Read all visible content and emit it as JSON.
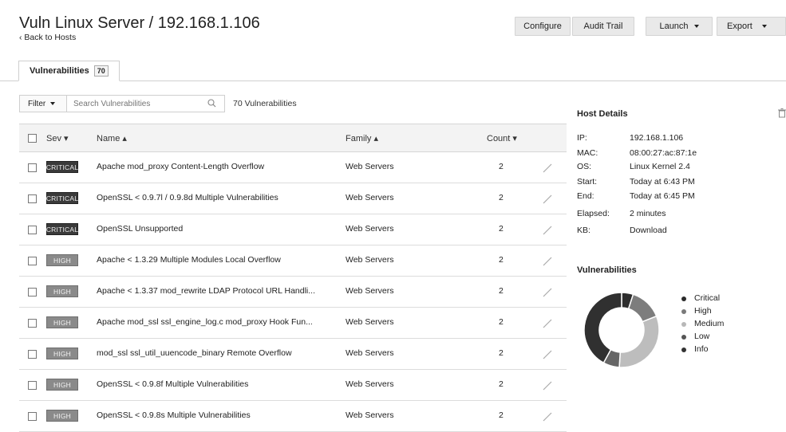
{
  "header": {
    "title": "Vuln Linux Server / 192.168.1.106",
    "back_link": "‹ Back to Hosts",
    "buttons": {
      "configure": "Configure",
      "audit_trail": "Audit Trail",
      "launch": "Launch",
      "export": "Export"
    }
  },
  "tabs": [
    {
      "label": "Vulnerabilities",
      "count": "70"
    }
  ],
  "toolbar": {
    "filter_label": "Filter",
    "search_placeholder": "Search Vulnerabilities",
    "result_count": "70 Vulnerabilities"
  },
  "table": {
    "columns": {
      "sev": "Sev ▾",
      "name": "Name ▴",
      "family": "Family ▴",
      "count": "Count ▾"
    },
    "rows": [
      {
        "sev": "CRITICAL",
        "name": "Apache mod_proxy Content-Length Overflow",
        "family": "Web Servers",
        "count": "2"
      },
      {
        "sev": "CRITICAL",
        "name": "OpenSSL < 0.9.7l / 0.9.8d Multiple Vulnerabilities",
        "family": "Web Servers",
        "count": "2"
      },
      {
        "sev": "CRITICAL",
        "name": "OpenSSL Unsupported",
        "family": "Web Servers",
        "count": "2"
      },
      {
        "sev": "HIGH",
        "name": "Apache < 1.3.29 Multiple Modules Local Overflow",
        "family": "Web Servers",
        "count": "2"
      },
      {
        "sev": "HIGH",
        "name": "Apache < 1.3.37 mod_rewrite LDAP Protocol URL Handli...",
        "family": "Web Servers",
        "count": "2"
      },
      {
        "sev": "HIGH",
        "name": "Apache mod_ssl ssl_engine_log.c mod_proxy Hook Fun...",
        "family": "Web Servers",
        "count": "2"
      },
      {
        "sev": "HIGH",
        "name": "mod_ssl ssl_util_uuencode_binary Remote Overflow",
        "family": "Web Servers",
        "count": "2"
      },
      {
        "sev": "HIGH",
        "name": "OpenSSL < 0.9.8f Multiple Vulnerabilities",
        "family": "Web Servers",
        "count": "2"
      },
      {
        "sev": "HIGH",
        "name": "OpenSSL < 0.9.8s Multiple Vulnerabilities",
        "family": "Web Servers",
        "count": "2"
      }
    ]
  },
  "host_details": {
    "title": "Host Details",
    "fields": [
      {
        "key": "IP:",
        "value": "192.168.1.106"
      },
      {
        "key": "MAC:",
        "value": "08:00:27:ac:87:1e"
      },
      {
        "key": "OS:",
        "value": "Linux Kernel 2.4"
      },
      {
        "key": "Start:",
        "value": "Today at 6:43 PM"
      },
      {
        "key": "End:",
        "value": "Today at 6:45 PM"
      },
      {
        "key": "Elapsed:",
        "value": "2 minutes"
      },
      {
        "key": "KB:",
        "value": "Download"
      }
    ]
  },
  "vuln_chart": {
    "title": "Vulnerabilities",
    "legend": [
      {
        "label": "Critical",
        "color": "#2b2b2b"
      },
      {
        "label": "High",
        "color": "#7a7a7a"
      },
      {
        "label": "Medium",
        "color": "#b8b8b8"
      },
      {
        "label": "Low",
        "color": "#555555"
      },
      {
        "label": "Info",
        "color": "#333333"
      }
    ],
    "slice_fractions": {
      "critical": 0.05,
      "high": 0.14,
      "medium": 0.32,
      "low": 0.07,
      "info": 0.42
    }
  },
  "colors": {
    "critical_badge": "#3a3a3a",
    "high_badge": "#8a8a8a",
    "header_bg": "#f3f3f3"
  }
}
